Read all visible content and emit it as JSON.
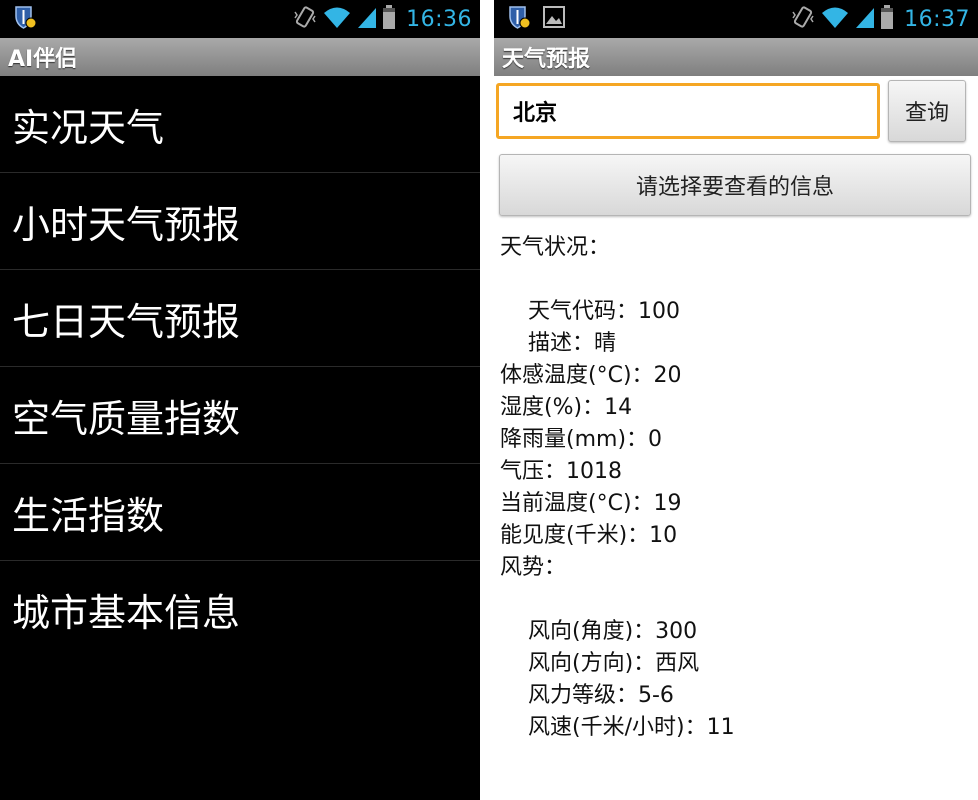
{
  "left_screen": {
    "status_time": "16:36",
    "app_title": "AI伴侣",
    "menu": [
      {
        "label": "实况天气"
      },
      {
        "label": "小时天气预报"
      },
      {
        "label": "七日天气预报"
      },
      {
        "label": "空气质量指数"
      },
      {
        "label": "生活指数"
      },
      {
        "label": "城市基本信息"
      }
    ]
  },
  "right_screen": {
    "status_time": "16:37",
    "app_title": "天气预报",
    "city_value": "北京",
    "query_label": "查询",
    "select_label": "请选择要查看的信息",
    "weather_status_header": "天气状况：",
    "weather_code": "天气代码：100",
    "description": "描述：晴",
    "feels_like": "体感温度(°C)：20",
    "humidity": "湿度(%)：14",
    "precipitation": "降雨量(mm)：0",
    "pressure": "气压：1018",
    "current_temp": "当前温度(°C)：19",
    "visibility": "能见度(千米)：10",
    "wind_header": "风势：",
    "wind_direction_degree": "风向(角度)：300",
    "wind_direction": "风向(方向)：西风",
    "wind_scale": "风力等级：5-6",
    "wind_speed": "风速(千米/小时)：11"
  },
  "colors": {
    "status_accent": "#33b5e5",
    "input_focus_border": "#f5a623",
    "left_background": "#000000",
    "right_background": "#ffffff"
  },
  "icons": [
    "shield-icon",
    "image-icon",
    "vibrate-icon",
    "wifi-icon",
    "signal-icon",
    "battery-icon"
  ]
}
